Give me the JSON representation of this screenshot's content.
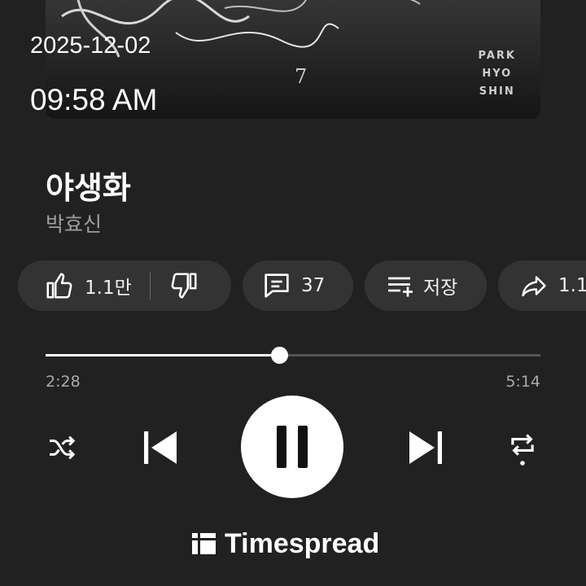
{
  "overlay": {
    "date": "2025-12-02",
    "time": "09:58 AM"
  },
  "album": {
    "credit_lines": [
      "PARK",
      "HYO",
      "SHIN"
    ],
    "number": "7"
  },
  "song": {
    "title": "야생화",
    "artist": "박효신"
  },
  "actions": {
    "like_count": "1.1만",
    "comments_count": "37",
    "save_label": "저장",
    "share_label": "1.1"
  },
  "player": {
    "current_time": "2:28",
    "total_time": "5:14",
    "progress": 0.4714,
    "state": "playing"
  },
  "brand": {
    "name": "Timespread",
    "icon": "timespread-logo-icon"
  },
  "icons": [
    "thumb-up-icon",
    "thumb-down-icon",
    "comment-icon",
    "playlist-add-icon",
    "share-icon",
    "shuffle-icon",
    "skip-previous-icon",
    "pause-icon",
    "skip-next-icon",
    "repeat-icon"
  ],
  "colors": {
    "background": "#212121",
    "pill": "#333333",
    "text_secondary": "#9e9e9e",
    "accent": "#ffffff"
  }
}
